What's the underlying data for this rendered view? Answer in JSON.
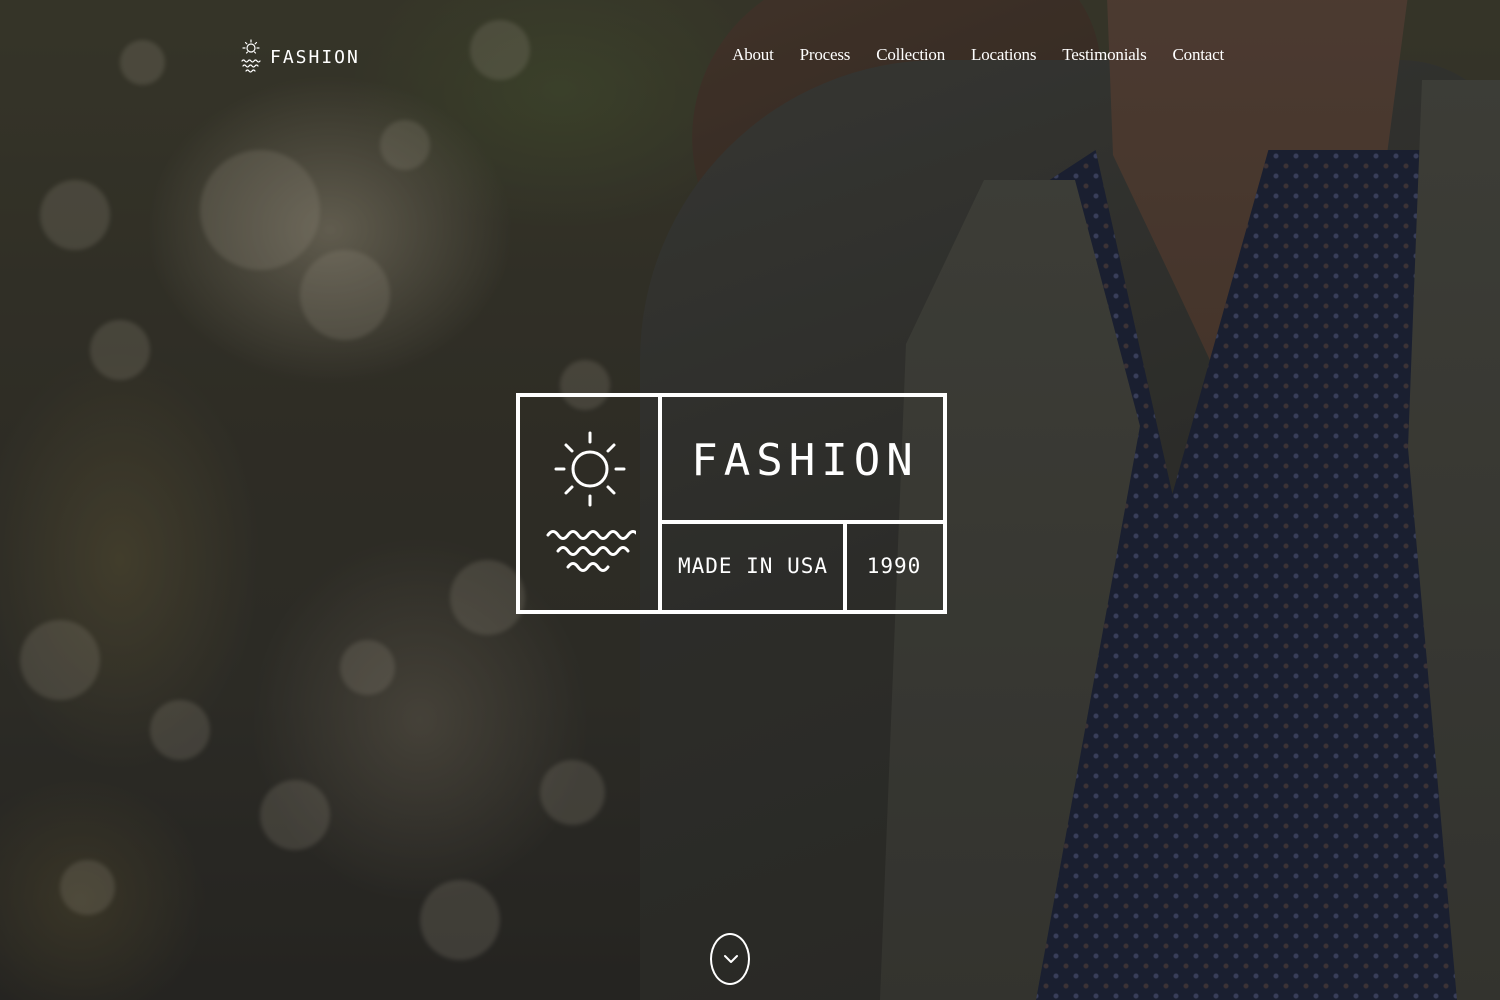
{
  "header": {
    "logo_text": "FASHION",
    "logo_icon": "sun-over-waves-icon"
  },
  "nav": {
    "items": [
      {
        "label": "About"
      },
      {
        "label": "Process"
      },
      {
        "label": "Collection"
      },
      {
        "label": "Locations"
      },
      {
        "label": "Testimonials"
      },
      {
        "label": "Contact"
      }
    ]
  },
  "hero": {
    "badge": {
      "title": "FASHION",
      "made_in": "MADE IN USA",
      "year": "1990",
      "icon": "sun-over-waves-icon"
    },
    "scroll_icon": "chevron-down-icon"
  },
  "colors": {
    "text": "#ffffff",
    "overlay": "#141210"
  }
}
